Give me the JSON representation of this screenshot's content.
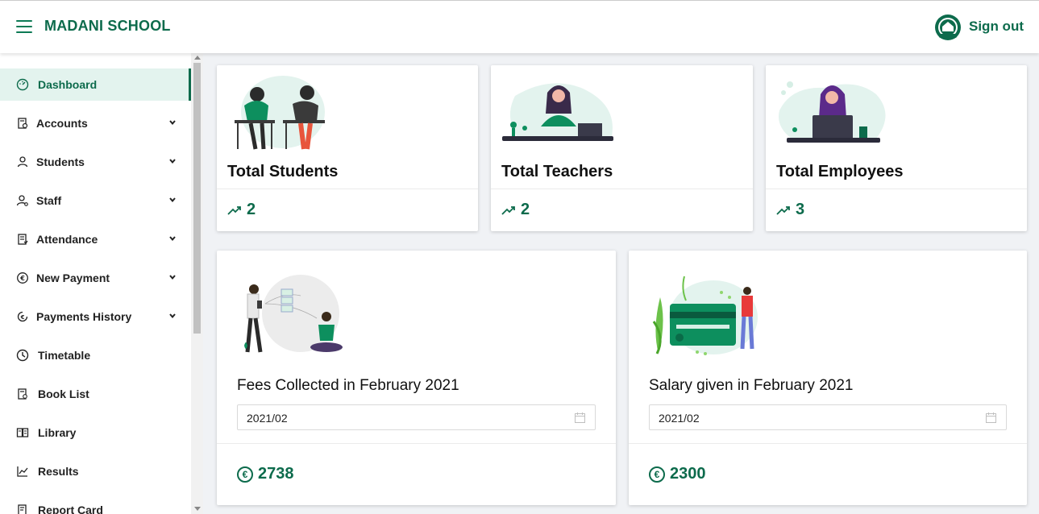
{
  "header": {
    "brand": "MADANI SCHOOL",
    "sign_out": "Sign out"
  },
  "sidebar": {
    "items": [
      {
        "label": "Dashboard",
        "icon": "dashboard-icon",
        "active": true
      },
      {
        "label": "Accounts",
        "icon": "accounts-icon",
        "expandable": true
      },
      {
        "label": "Students",
        "icon": "user-icon",
        "expandable": true
      },
      {
        "label": "Staff",
        "icon": "staff-icon",
        "expandable": true
      },
      {
        "label": "Attendance",
        "icon": "attendance-icon",
        "expandable": true
      },
      {
        "label": "New Payment",
        "icon": "euro-icon",
        "expandable": true
      },
      {
        "label": "Payments History",
        "icon": "history-icon",
        "expandable": true
      },
      {
        "label": "Timetable",
        "icon": "clock-icon"
      },
      {
        "label": "Book List",
        "icon": "book-list-icon"
      },
      {
        "label": "Library",
        "icon": "library-icon"
      },
      {
        "label": "Results",
        "icon": "chart-icon"
      },
      {
        "label": "Report Card",
        "icon": "report-card-icon"
      }
    ]
  },
  "stats": {
    "students": {
      "title": "Total Students",
      "value": "2"
    },
    "teachers": {
      "title": "Total Teachers",
      "value": "2"
    },
    "employees": {
      "title": "Total Employees",
      "value": "3"
    }
  },
  "fees": {
    "title": "Fees Collected in February 2021",
    "month": "2021/02",
    "amount": "2738"
  },
  "salary": {
    "title": "Salary given in February 2021",
    "month": "2021/02",
    "amount": "2300"
  },
  "colors": {
    "brand": "#0d6b4c",
    "active_bg": "#e3f3ee"
  }
}
